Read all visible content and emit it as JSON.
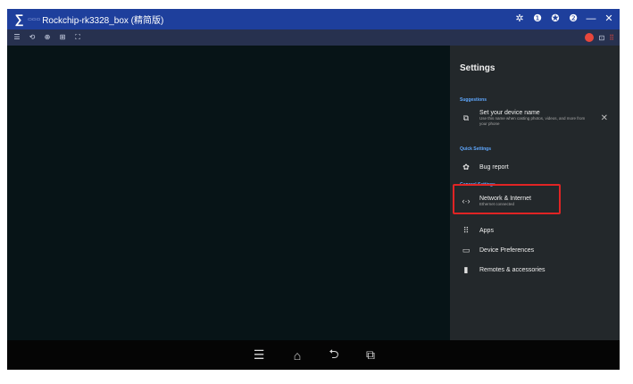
{
  "window": {
    "logo_symbol": "∑",
    "logo_sub": "▭▭▭",
    "title": "Rockchip-rk3328_box (精简版)"
  },
  "title_controls": {
    "settings_icon": "✲",
    "info_icon": "❶",
    "pin_icon": "✪",
    "help_icon": "❷",
    "minimize": "—",
    "close": "✕"
  },
  "toolbar": {
    "menu": "☰",
    "rotate": "⟲",
    "zoom": "⊕",
    "screenshot": "⊞",
    "fullscreen": "⛶",
    "right_icon_2": "⊡",
    "right_icon_3": "⠿"
  },
  "settings": {
    "title": "Settings",
    "sections": {
      "suggestions": "Suggestions",
      "quick": "Quick Settings",
      "general": "General Settings"
    },
    "suggestion": {
      "title": "Set your device name",
      "subtitle": "Use this name when casting photos, videos, and more from your phone",
      "dismiss": "✕"
    },
    "items": [
      {
        "icon": "✿",
        "title": "Bug report",
        "subtitle": ""
      },
      {
        "icon": "‹·›",
        "title": "Network & Internet",
        "subtitle": "Ethernet connected"
      },
      {
        "icon": "⠿",
        "title": "Apps",
        "subtitle": ""
      },
      {
        "icon": "▭",
        "title": "Device Preferences",
        "subtitle": ""
      },
      {
        "icon": "▮",
        "title": "Remotes & accessories",
        "subtitle": ""
      }
    ],
    "suggestion_icon": "⧉"
  },
  "navbar": {
    "menu": "☰",
    "home": "⌂",
    "back": "⮌",
    "recents": "⧉"
  },
  "colors": {
    "titlebar": "#1e3f9c",
    "toolbar": "#27314f",
    "screen": "#071417",
    "settings_panel": "#23282b",
    "section_label": "#5fa8ff",
    "highlight": "#e02424"
  }
}
